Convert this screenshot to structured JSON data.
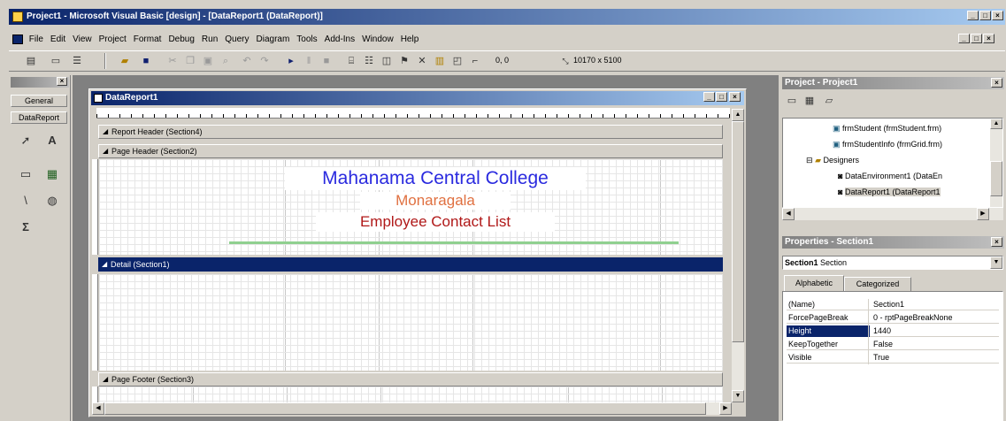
{
  "app": {
    "title": "Project1 - Microsoft Visual Basic [design] - [DataReport1 (DataReport)]",
    "min": "_",
    "max": "□",
    "close": "×"
  },
  "menu": [
    "File",
    "Edit",
    "View",
    "Project",
    "Format",
    "Debug",
    "Run",
    "Query",
    "Diagram",
    "Tools",
    "Add-Ins",
    "Window",
    "Help"
  ],
  "toolbar": {
    "position": "0, 0",
    "size": "10170 x 5100"
  },
  "toolbox": {
    "tabs": [
      "General",
      "DataReport"
    ]
  },
  "report": {
    "title": "DataReport1",
    "sections": {
      "report_header": "Report Header (Section4)",
      "page_header": "Page Header (Section2)",
      "detail": "Detail (Section1)",
      "page_footer": "Page Footer (Section3)"
    },
    "labels": {
      "line1": "Mahanama Central College",
      "line2": "Monaragala",
      "line3": "Employee Contact List"
    },
    "colors": {
      "line1": "#2a2adf",
      "line2": "#e07040",
      "line3": "#b01818"
    }
  },
  "project": {
    "title": "Project - Project1",
    "items": [
      "frmStudent (frmStudent.frm)",
      "frmStudentInfo (frmGrid.frm)",
      "Designers",
      "DataEnvironment1 (DataEn",
      "DataReport1 (DataReport1"
    ]
  },
  "properties": {
    "title": "Properties - Section1",
    "object": "Section1",
    "object_type": "Section",
    "tabs": [
      "Alphabetic",
      "Categorized"
    ],
    "rows": [
      {
        "name": "(Name)",
        "value": "Section1"
      },
      {
        "name": "ForcePageBreak",
        "value": "0 - rptPageBreakNone"
      },
      {
        "name": "Height",
        "value": "1440"
      },
      {
        "name": "KeepTogether",
        "value": "False"
      },
      {
        "name": "Visible",
        "value": "True"
      }
    ]
  }
}
